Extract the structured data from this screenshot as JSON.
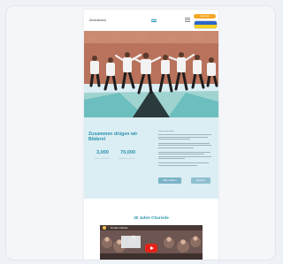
{
  "header": {
    "logo_text": "Deutschland",
    "cta_label": "Spenden",
    "lang_flag": "ukraine-flag"
  },
  "info": {
    "headline": "Zusammen drügen wir Bildern!",
    "stats": [
      {
        "value": "3,000",
        "label": "Kinder unterstützt"
      },
      {
        "value": "70,000",
        "label": "Mahlzeiten verteilt"
      }
    ],
    "paragraph_lead": "Unsere Geschichte",
    "buttons": [
      "Mehr erfahren",
      "Spenden"
    ]
  },
  "video": {
    "section_title": "30 Jahre Charisde",
    "player_title": "30 Jahre Charisde",
    "play_icon": "youtube-play-icon"
  },
  "colors": {
    "accent": "#2a92ad",
    "cta": "#f5a623",
    "section_bg": "#dbeef4"
  }
}
